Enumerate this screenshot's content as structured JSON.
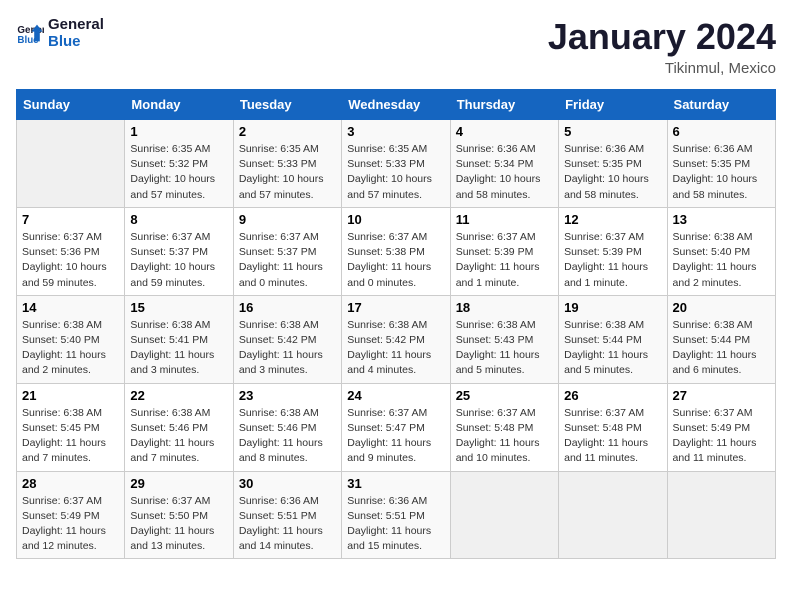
{
  "header": {
    "logo_line1": "General",
    "logo_line2": "Blue",
    "title": "January 2024",
    "subtitle": "Tikinmul, Mexico"
  },
  "days_of_week": [
    "Sunday",
    "Monday",
    "Tuesday",
    "Wednesday",
    "Thursday",
    "Friday",
    "Saturday"
  ],
  "weeks": [
    [
      {
        "day": "",
        "info": ""
      },
      {
        "day": "1",
        "info": "Sunrise: 6:35 AM\nSunset: 5:32 PM\nDaylight: 10 hours and 57 minutes."
      },
      {
        "day": "2",
        "info": "Sunrise: 6:35 AM\nSunset: 5:33 PM\nDaylight: 10 hours and 57 minutes."
      },
      {
        "day": "3",
        "info": "Sunrise: 6:35 AM\nSunset: 5:33 PM\nDaylight: 10 hours and 57 minutes."
      },
      {
        "day": "4",
        "info": "Sunrise: 6:36 AM\nSunset: 5:34 PM\nDaylight: 10 hours and 58 minutes."
      },
      {
        "day": "5",
        "info": "Sunrise: 6:36 AM\nSunset: 5:35 PM\nDaylight: 10 hours and 58 minutes."
      },
      {
        "day": "6",
        "info": "Sunrise: 6:36 AM\nSunset: 5:35 PM\nDaylight: 10 hours and 58 minutes."
      }
    ],
    [
      {
        "day": "7",
        "info": "Sunrise: 6:37 AM\nSunset: 5:36 PM\nDaylight: 10 hours and 59 minutes."
      },
      {
        "day": "8",
        "info": "Sunrise: 6:37 AM\nSunset: 5:37 PM\nDaylight: 10 hours and 59 minutes."
      },
      {
        "day": "9",
        "info": "Sunrise: 6:37 AM\nSunset: 5:37 PM\nDaylight: 11 hours and 0 minutes."
      },
      {
        "day": "10",
        "info": "Sunrise: 6:37 AM\nSunset: 5:38 PM\nDaylight: 11 hours and 0 minutes."
      },
      {
        "day": "11",
        "info": "Sunrise: 6:37 AM\nSunset: 5:39 PM\nDaylight: 11 hours and 1 minute."
      },
      {
        "day": "12",
        "info": "Sunrise: 6:37 AM\nSunset: 5:39 PM\nDaylight: 11 hours and 1 minute."
      },
      {
        "day": "13",
        "info": "Sunrise: 6:38 AM\nSunset: 5:40 PM\nDaylight: 11 hours and 2 minutes."
      }
    ],
    [
      {
        "day": "14",
        "info": "Sunrise: 6:38 AM\nSunset: 5:40 PM\nDaylight: 11 hours and 2 minutes."
      },
      {
        "day": "15",
        "info": "Sunrise: 6:38 AM\nSunset: 5:41 PM\nDaylight: 11 hours and 3 minutes."
      },
      {
        "day": "16",
        "info": "Sunrise: 6:38 AM\nSunset: 5:42 PM\nDaylight: 11 hours and 3 minutes."
      },
      {
        "day": "17",
        "info": "Sunrise: 6:38 AM\nSunset: 5:42 PM\nDaylight: 11 hours and 4 minutes."
      },
      {
        "day": "18",
        "info": "Sunrise: 6:38 AM\nSunset: 5:43 PM\nDaylight: 11 hours and 5 minutes."
      },
      {
        "day": "19",
        "info": "Sunrise: 6:38 AM\nSunset: 5:44 PM\nDaylight: 11 hours and 5 minutes."
      },
      {
        "day": "20",
        "info": "Sunrise: 6:38 AM\nSunset: 5:44 PM\nDaylight: 11 hours and 6 minutes."
      }
    ],
    [
      {
        "day": "21",
        "info": "Sunrise: 6:38 AM\nSunset: 5:45 PM\nDaylight: 11 hours and 7 minutes."
      },
      {
        "day": "22",
        "info": "Sunrise: 6:38 AM\nSunset: 5:46 PM\nDaylight: 11 hours and 7 minutes."
      },
      {
        "day": "23",
        "info": "Sunrise: 6:38 AM\nSunset: 5:46 PM\nDaylight: 11 hours and 8 minutes."
      },
      {
        "day": "24",
        "info": "Sunrise: 6:37 AM\nSunset: 5:47 PM\nDaylight: 11 hours and 9 minutes."
      },
      {
        "day": "25",
        "info": "Sunrise: 6:37 AM\nSunset: 5:48 PM\nDaylight: 11 hours and 10 minutes."
      },
      {
        "day": "26",
        "info": "Sunrise: 6:37 AM\nSunset: 5:48 PM\nDaylight: 11 hours and 11 minutes."
      },
      {
        "day": "27",
        "info": "Sunrise: 6:37 AM\nSunset: 5:49 PM\nDaylight: 11 hours and 11 minutes."
      }
    ],
    [
      {
        "day": "28",
        "info": "Sunrise: 6:37 AM\nSunset: 5:49 PM\nDaylight: 11 hours and 12 minutes."
      },
      {
        "day": "29",
        "info": "Sunrise: 6:37 AM\nSunset: 5:50 PM\nDaylight: 11 hours and 13 minutes."
      },
      {
        "day": "30",
        "info": "Sunrise: 6:36 AM\nSunset: 5:51 PM\nDaylight: 11 hours and 14 minutes."
      },
      {
        "day": "31",
        "info": "Sunrise: 6:36 AM\nSunset: 5:51 PM\nDaylight: 11 hours and 15 minutes."
      },
      {
        "day": "",
        "info": ""
      },
      {
        "day": "",
        "info": ""
      },
      {
        "day": "",
        "info": ""
      }
    ]
  ]
}
